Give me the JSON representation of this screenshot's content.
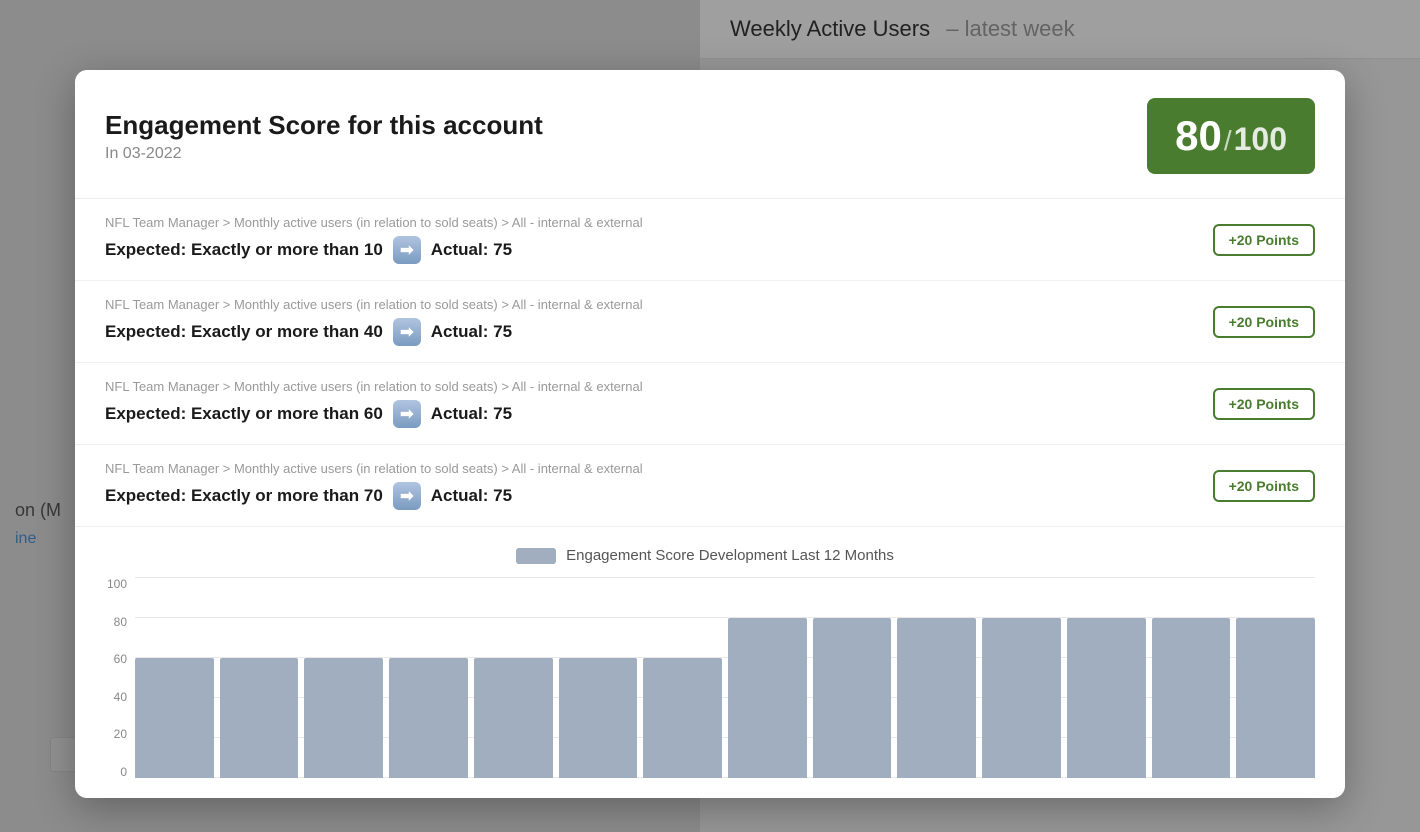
{
  "background": {
    "header": {
      "title": "Weekly Active Users",
      "separator": "–",
      "subtitle": "latest week"
    },
    "left_panel": {
      "text1": "on (M",
      "link_text": "ine"
    }
  },
  "modal": {
    "title": "Engagement Score for this account",
    "subtitle": "In 03-2022",
    "score": {
      "value": "80",
      "separator": "/",
      "max": "100"
    },
    "criteria": [
      {
        "path": "NFL Team Manager > Monthly active users (in relation to sold seats) > All - internal & external",
        "expected": "Expected: Exactly or more than 10",
        "actual": "Actual: 75",
        "points": "+20 Points"
      },
      {
        "path": "NFL Team Manager > Monthly active users (in relation to sold seats) > All - internal & external",
        "expected": "Expected: Exactly or more than 40",
        "actual": "Actual: 75",
        "points": "+20 Points"
      },
      {
        "path": "NFL Team Manager > Monthly active users (in relation to sold seats) > All - internal & external",
        "expected": "Expected: Exactly or more than 60",
        "actual": "Actual: 75",
        "points": "+20 Points"
      },
      {
        "path": "NFL Team Manager > Monthly active users (in relation to sold seats) > All - internal & external",
        "expected": "Expected: Exactly or more than 70",
        "actual": "Actual: 75",
        "points": "+20 Points"
      }
    ],
    "chart": {
      "legend_label": "Engagement Score Development Last 12 Months",
      "y_labels": [
        "100",
        "80",
        "60",
        "40",
        "20",
        "0"
      ],
      "bars": [
        {
          "height_pct": 60
        },
        {
          "height_pct": 60
        },
        {
          "height_pct": 60
        },
        {
          "height_pct": 60
        },
        {
          "height_pct": 60
        },
        {
          "height_pct": 60
        },
        {
          "height_pct": 60
        },
        {
          "height_pct": 80
        },
        {
          "height_pct": 80
        },
        {
          "height_pct": 80
        },
        {
          "height_pct": 80
        },
        {
          "height_pct": 80
        },
        {
          "height_pct": 80
        },
        {
          "height_pct": 80
        }
      ]
    }
  }
}
